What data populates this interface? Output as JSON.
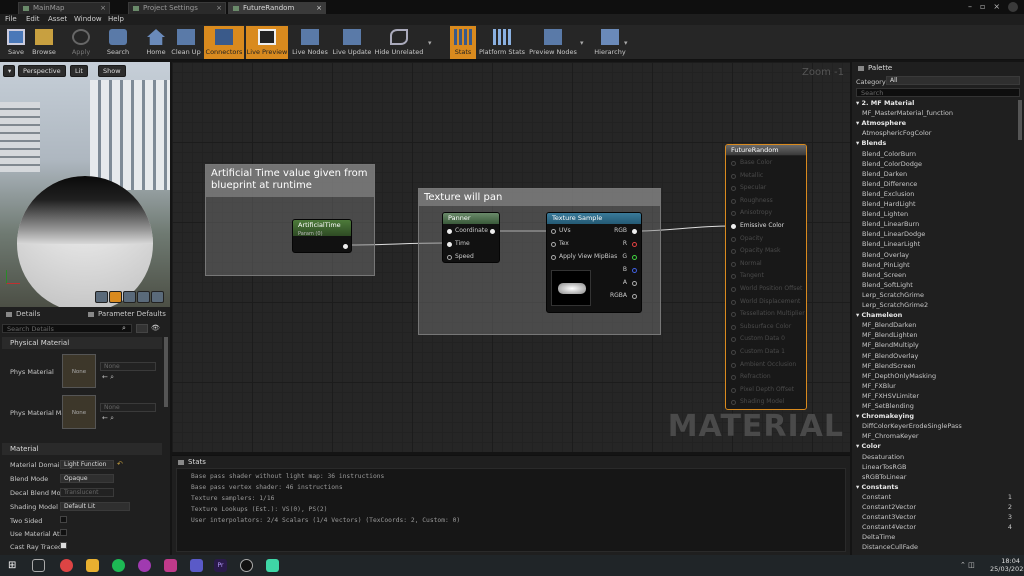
{
  "tabs": [
    {
      "label": "MainMap",
      "active": false
    },
    {
      "label": "Project Settings",
      "active": false
    },
    {
      "label": "FutureRandom",
      "active": true
    }
  ],
  "menu": [
    "File",
    "Edit",
    "Asset",
    "Window",
    "Help"
  ],
  "toolbar": [
    {
      "label": "Save",
      "icon": "save-icon",
      "active": false
    },
    {
      "label": "Browse",
      "icon": "browse-icon",
      "active": false
    },
    {
      "label": "Apply",
      "icon": "apply-icon",
      "active": false
    },
    {
      "label": "Search",
      "icon": "search-icon",
      "active": false
    },
    {
      "label": "Home",
      "icon": "home-icon",
      "active": false
    },
    {
      "label": "Clean Up",
      "icon": "cleanup-icon",
      "active": false
    },
    {
      "label": "Connectors",
      "icon": "connectors-icon",
      "active": true
    },
    {
      "label": "Live Preview",
      "icon": "live-preview-icon",
      "active": true
    },
    {
      "label": "Live Nodes",
      "icon": "live-nodes-icon",
      "active": false
    },
    {
      "label": "Live Update",
      "icon": "live-update-icon",
      "active": false
    },
    {
      "label": "Hide Unrelated",
      "icon": "hide-unrelated-icon",
      "active": false
    },
    {
      "label": "Stats",
      "icon": "stats-icon",
      "active": true
    },
    {
      "label": "Platform Stats",
      "icon": "platform-stats-icon",
      "active": false
    },
    {
      "label": "Preview Nodes",
      "icon": "preview-nodes-icon",
      "active": false
    },
    {
      "label": "Hierarchy",
      "icon": "hierarchy-icon",
      "active": false
    }
  ],
  "viewport": {
    "perspective": "Perspective",
    "lit": "Lit",
    "show": "Show"
  },
  "details": {
    "tab_details": "Details",
    "tab_params": "Parameter Defaults",
    "search_placeholder": "Search Details",
    "section_physical": "Physical Material",
    "phys_material_label": "Phys Material",
    "phys_material_mask_label": "Phys Material Ma",
    "none": "None",
    "section_material": "Material",
    "material_domain_label": "Material Domain",
    "material_domain_value": "Light Function",
    "blend_mode_label": "Blend Mode",
    "blend_mode_value": "Opaque",
    "decal_blend_label": "Decal Blend Mode",
    "decal_blend_value": "Translucent",
    "shading_model_label": "Shading Model",
    "shading_model_value": "Default Lit",
    "two_sided_label": "Two Sided",
    "use_attr_label": "Use Material Attri",
    "cast_ray_label": "Cast Ray Traced"
  },
  "graph": {
    "zoom": "Zoom -1",
    "watermark": "MATERIAL",
    "comment1": "Artificial Time value given from blueprint at runtime",
    "comment2": "Texture will pan",
    "node_time_title": "ArtificialTime",
    "node_time_sub": "Param (0)",
    "node_panner_title": "Panner",
    "panner_pins": [
      "Coordinate",
      "Time",
      "Speed"
    ],
    "node_texture_title": "Texture Sample",
    "texture_inputs": [
      "UVs",
      "Tex",
      "Apply View MipBias"
    ],
    "texture_outputs": [
      "RGB",
      "R",
      "G",
      "B",
      "A",
      "RGBA"
    ],
    "result_title": "FutureRandom",
    "result_pins": [
      "Base Color",
      "Metallic",
      "Specular",
      "Roughness",
      "Anisotropy",
      "Emissive Color",
      "Opacity",
      "Opacity Mask",
      "Normal",
      "Tangent",
      "World Position Offset",
      "World Displacement",
      "Tessellation Multiplier",
      "Subsurface Color",
      "Custom Data 0",
      "Custom Data 1",
      "Ambient Occlusion",
      "Refraction",
      "Pixel Depth Offset",
      "Shading Model"
    ]
  },
  "stats": {
    "title": "Stats",
    "lines": [
      "Base pass shader without light map: 36 instructions",
      "Base pass vertex shader: 46 instructions",
      "Texture samplers: 1/16",
      "Texture Lookups (Est.): VS(0), PS(2)",
      "User interpolators: 2/4 Scalars (1/4 Vectors) (TexCoords: 2, Custom: 0)"
    ]
  },
  "palette": {
    "title": "Palette",
    "category_label": "Category",
    "category_value": "All",
    "search_placeholder": "Search",
    "items": [
      {
        "t": "c",
        "label": "2. MF Material"
      },
      {
        "t": "i",
        "label": "MF_MasterMaterial_function"
      },
      {
        "t": "c",
        "label": "Atmosphere"
      },
      {
        "t": "i",
        "label": "AtmosphericFogColor"
      },
      {
        "t": "c",
        "label": "Blends"
      },
      {
        "t": "i",
        "label": "Blend_ColorBurn"
      },
      {
        "t": "i",
        "label": "Blend_ColorDodge"
      },
      {
        "t": "i",
        "label": "Blend_Darken"
      },
      {
        "t": "i",
        "label": "Blend_Difference"
      },
      {
        "t": "i",
        "label": "Blend_Exclusion"
      },
      {
        "t": "i",
        "label": "Blend_HardLight"
      },
      {
        "t": "i",
        "label": "Blend_Lighten"
      },
      {
        "t": "i",
        "label": "Blend_LinearBurn"
      },
      {
        "t": "i",
        "label": "Blend_LinearDodge"
      },
      {
        "t": "i",
        "label": "Blend_LinearLight"
      },
      {
        "t": "i",
        "label": "Blend_Overlay"
      },
      {
        "t": "i",
        "label": "Blend_PinLight"
      },
      {
        "t": "i",
        "label": "Blend_Screen"
      },
      {
        "t": "i",
        "label": "Blend_SoftLight"
      },
      {
        "t": "i",
        "label": "Lerp_ScratchGrime"
      },
      {
        "t": "i",
        "label": "Lerp_ScratchGrime2"
      },
      {
        "t": "c",
        "label": "Chameleon"
      },
      {
        "t": "i",
        "label": "MF_BlendDarken"
      },
      {
        "t": "i",
        "label": "MF_BlendLighten"
      },
      {
        "t": "i",
        "label": "MF_BlendMultiply"
      },
      {
        "t": "i",
        "label": "MF_BlendOverlay"
      },
      {
        "t": "i",
        "label": "MF_BlendScreen"
      },
      {
        "t": "i",
        "label": "MF_DepthOnlyMasking"
      },
      {
        "t": "i",
        "label": "MF_FXBlur"
      },
      {
        "t": "i",
        "label": "MF_FXHSVLimiter"
      },
      {
        "t": "i",
        "label": "MF_SetBlending"
      },
      {
        "t": "c",
        "label": "Chromakeying"
      },
      {
        "t": "i",
        "label": "DiffColorKeyerErodeSinglePass"
      },
      {
        "t": "i",
        "label": "MF_ChromaKeyer"
      },
      {
        "t": "c",
        "label": "Color"
      },
      {
        "t": "i",
        "label": "Desaturation"
      },
      {
        "t": "i",
        "label": "LinearTosRGB"
      },
      {
        "t": "i",
        "label": "sRGBToLinear"
      },
      {
        "t": "c",
        "label": "Constants"
      },
      {
        "t": "i",
        "label": "Constant",
        "num": "1"
      },
      {
        "t": "i",
        "label": "Constant2Vector",
        "num": "2"
      },
      {
        "t": "i",
        "label": "Constant3Vector",
        "num": "3"
      },
      {
        "t": "i",
        "label": "Constant4Vector",
        "num": "4"
      },
      {
        "t": "i",
        "label": "DeltaTime"
      },
      {
        "t": "i",
        "label": "DistanceCullFade"
      }
    ]
  },
  "taskbar": {
    "time": "18:04",
    "date": "25/03/2022"
  }
}
